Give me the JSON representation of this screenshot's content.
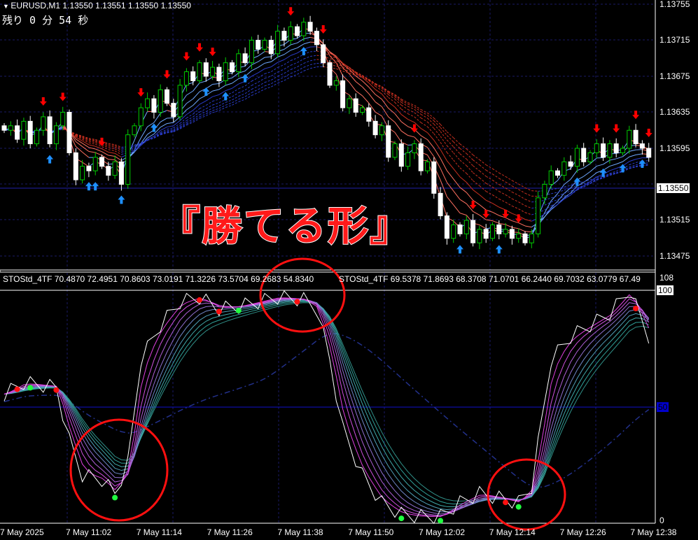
{
  "header": {
    "symbol_line": "EURUSD,M1  1.13550 1.13551 1.13550 1.13550",
    "countdown": "残り 0 分 54 秒"
  },
  "annotation_text": "『勝てる形』",
  "indicator_header": {
    "label_1": "STOStd_4TF 70.4870 72.4951 70.8603 73.0191 71.3226 73.5704 69.2683 54.8340",
    "label_2": "STOStd_4TF 69.5378 71.8693 68.3708 71.0701 66.2440 69.7032 63.0779 67.49"
  },
  "colors": {
    "bull": "#00cc00",
    "bear": "#ffffff",
    "up_arrow": "#1e90ff",
    "down_arrow": "#ff0000",
    "circle": "#ff0000",
    "grid": "#1a1a66"
  },
  "chart_data": [
    {
      "type": "candlestick",
      "title": "EURUSD,M1",
      "y_ticks": [
        "1.13755",
        "1.13715",
        "1.13675",
        "1.13635",
        "1.13595",
        "1.13515",
        "1.13475"
      ],
      "current_price": "1.13550",
      "ylim": [
        1.1345,
        1.1376
      ],
      "x_ticks": [
        "7 May 2025",
        "7 May 11:02",
        "7 May 11:14",
        "7 May 11:26",
        "7 May 11:38",
        "7 May 11:50",
        "7 May 12:02",
        "7 May 12:14",
        "7 May 12:26",
        "7 May 12:38"
      ],
      "closes": [
        1.13615,
        1.1362,
        1.13605,
        1.13625,
        1.136,
        1.13615,
        1.1363,
        1.136,
        1.1362,
        1.13635,
        1.1359,
        1.1356,
        1.13575,
        1.1357,
        1.13585,
        1.13575,
        1.13565,
        1.1358,
        1.13555,
        1.1361,
        1.1362,
        1.1364,
        1.1365,
        1.13635,
        1.1366,
        1.13645,
        1.1363,
        1.13665,
        1.1368,
        1.1367,
        1.1369,
        1.13675,
        1.13685,
        1.1367,
        1.1369,
        1.1368,
        1.137,
        1.1369,
        1.13715,
        1.13705,
        1.13715,
        1.137,
        1.13725,
        1.13715,
        1.1373,
        1.1372,
        1.13735,
        1.13725,
        1.1371,
        1.1369,
        1.13665,
        1.1367,
        1.1364,
        1.1365,
        1.13635,
        1.1364,
        1.13625,
        1.1361,
        1.1362,
        1.13585,
        1.136,
        1.13575,
        1.1359,
        1.136,
        1.1357,
        1.1358,
        1.13545,
        1.1352,
        1.13495,
        1.1351,
        1.135,
        1.13515,
        1.1349,
        1.13505,
        1.13495,
        1.1351,
        1.135,
        1.13505,
        1.13495,
        1.135,
        1.1349,
        1.135,
        1.1354,
        1.13555,
        1.1357,
        1.13565,
        1.1358,
        1.13575,
        1.13595,
        1.1358,
        1.1359,
        1.136,
        1.13585,
        1.136,
        1.1359,
        1.13595,
        1.13615,
        1.136,
        1.13595,
        1.13585
      ],
      "up_arrow_bars": [
        7,
        13,
        14,
        18,
        23,
        31,
        34,
        37,
        46,
        70,
        76,
        88,
        92,
        95,
        98
      ],
      "down_arrow_bars": [
        6,
        9,
        15,
        21,
        25,
        28,
        30,
        32,
        44,
        49,
        63,
        72,
        74,
        77,
        79,
        91,
        94,
        97,
        99
      ]
    },
    {
      "type": "line",
      "title": "STOStd_4TF",
      "y_ticks": [
        "108",
        "100",
        "50",
        "0"
      ],
      "ylim": [
        0,
        108
      ],
      "main_line_keypoints": [
        [
          0,
          55
        ],
        [
          3,
          60
        ],
        [
          8,
          58
        ],
        [
          10,
          35
        ],
        [
          12,
          20
        ],
        [
          15,
          18
        ],
        [
          17,
          12
        ],
        [
          19,
          25
        ],
        [
          21,
          70
        ],
        [
          24,
          85
        ],
        [
          27,
          95
        ],
        [
          30,
          97
        ],
        [
          33,
          92
        ],
        [
          36,
          93
        ],
        [
          39,
          95
        ],
        [
          42,
          97
        ],
        [
          46,
          96
        ],
        [
          48,
          92
        ],
        [
          50,
          70
        ],
        [
          52,
          40
        ],
        [
          55,
          20
        ],
        [
          58,
          8
        ],
        [
          61,
          3
        ],
        [
          64,
          2
        ],
        [
          67,
          2
        ],
        [
          70,
          8
        ],
        [
          73,
          12
        ],
        [
          76,
          10
        ],
        [
          79,
          8
        ],
        [
          81,
          15
        ],
        [
          84,
          70
        ],
        [
          87,
          80
        ],
        [
          90,
          85
        ],
        [
          93,
          90
        ],
        [
          96,
          100
        ],
        [
          99,
          80
        ]
      ],
      "red_dot_bars": [
        2,
        8,
        30,
        33,
        45,
        77,
        97
      ],
      "green_dot_bars": [
        4,
        17,
        36,
        61,
        67,
        79
      ]
    }
  ]
}
